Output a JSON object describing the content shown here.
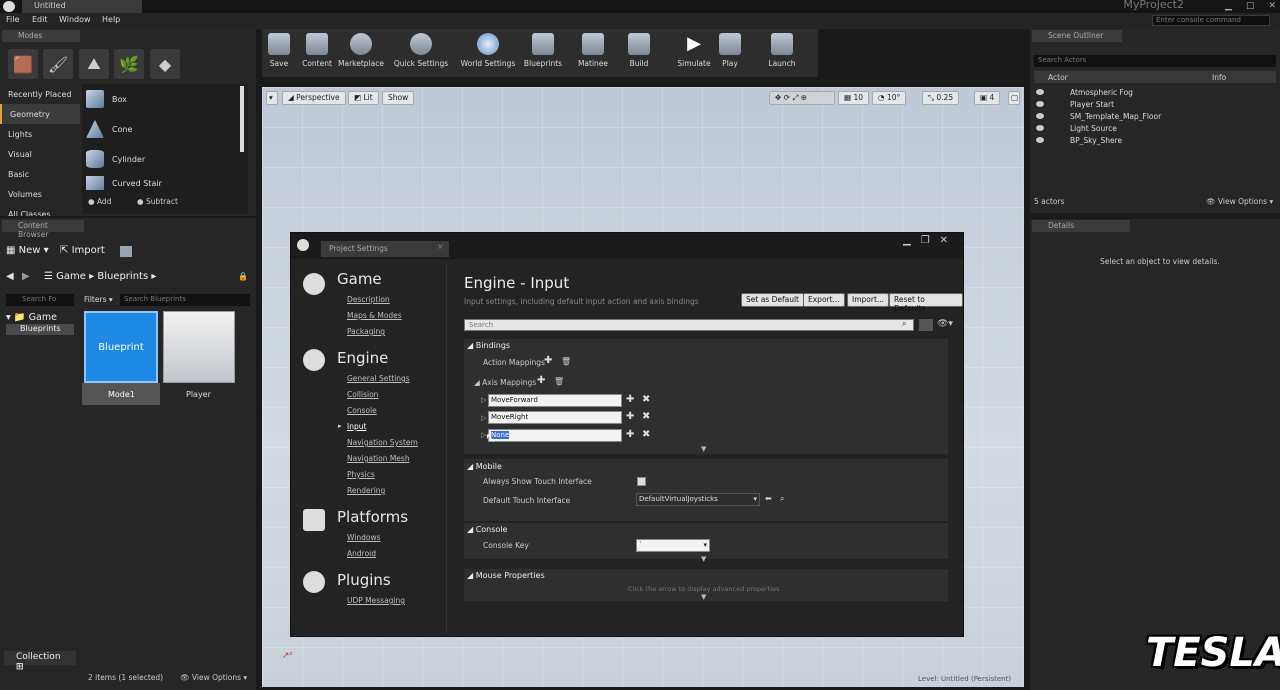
{
  "window": {
    "tab_title": "Untitled",
    "project_name": "MyProject2"
  },
  "menu": [
    "File",
    "Edit",
    "Window",
    "Help"
  ],
  "console_placeholder": "Enter console command",
  "modes": {
    "tab": "Modes",
    "categories": [
      "Recently Placed",
      "Geometry",
      "Lights",
      "Visual",
      "Basic",
      "Volumes",
      "All Classes"
    ],
    "items": [
      "Box",
      "Cone",
      "Cylinder",
      "Curved Stair"
    ],
    "add": "Add",
    "subtract": "Subtract"
  },
  "content_browser": {
    "tab": "Content Browser",
    "new": "New",
    "import": "Import",
    "path": [
      "Game",
      "Blueprints"
    ],
    "search_folders": "Search Fo",
    "filters": "Filters",
    "search_blueprints": "Search Blueprints",
    "tree": [
      "Game",
      "Blueprints"
    ],
    "assets": [
      {
        "thumb": "Blueprint",
        "name": "Mode1"
      },
      {
        "thumb": "",
        "name": "Player"
      }
    ],
    "collections": "Collection",
    "status": "2 items (1 selected)",
    "view_options": "View Options"
  },
  "toolbar": [
    "Save",
    "Content",
    "Marketplace",
    "Quick Settings",
    "World Settings",
    "Blueprints",
    "Matinee",
    "Build",
    "Simulate",
    "Play",
    "Launch"
  ],
  "viewport": {
    "perspective": "Perspective",
    "lit": "Lit",
    "show": "Show",
    "grid_snap": "10",
    "rot_snap": "10°",
    "scale_snap": "0.25",
    "cam_speed": "4",
    "level": "Level: Untitled (Persistent)"
  },
  "outliner": {
    "tab": "Scene Outliner",
    "search": "Search Actors",
    "col_actor": "Actor",
    "col_info": "Info",
    "actors": [
      "Atmospheric Fog",
      "Player Start",
      "SM_Template_Map_Floor",
      "Light Source",
      "BP_Sky_Shere"
    ],
    "count": "5 actors",
    "view_options": "View Options"
  },
  "details": {
    "tab": "Details",
    "empty": "Select an object to view details."
  },
  "project_settings": {
    "tab": "Project Settings",
    "sections": [
      {
        "name": "Game",
        "items": [
          "Description",
          "Maps & Modes",
          "Packaging"
        ]
      },
      {
        "name": "Engine",
        "items": [
          "General Settings",
          "Collision",
          "Console",
          "Input",
          "Navigation System",
          "Navigation Mesh",
          "Physics",
          "Rendering"
        ]
      },
      {
        "name": "Platforms",
        "items": [
          "Windows",
          "Android"
        ]
      },
      {
        "name": "Plugins",
        "items": [
          "UDP Messaging"
        ]
      }
    ],
    "heading": "Engine - Input",
    "subtitle": "Input settings, including default input action and axis bindings",
    "buttons": [
      "Set as Default",
      "Export...",
      "Import...",
      "Reset to Defaults"
    ],
    "search": "Search",
    "bindings": "Bindings",
    "action_mappings": "Action Mappings",
    "axis_mappings": "Axis Mappings",
    "axis_values": [
      "MoveForward",
      "MoveRight",
      "None"
    ],
    "mobile": "Mobile",
    "always_show_touch": "Always Show Touch Interface",
    "default_touch": "Default Touch Interface",
    "default_touch_value": "DefaultVirtualJoysticks",
    "console": "Console",
    "console_key": "Console Key",
    "console_key_value": "`",
    "mouse_properties": "Mouse Properties",
    "advanced_hint": "Click the arrow to display advanced properties"
  },
  "watermark": "TESLA"
}
